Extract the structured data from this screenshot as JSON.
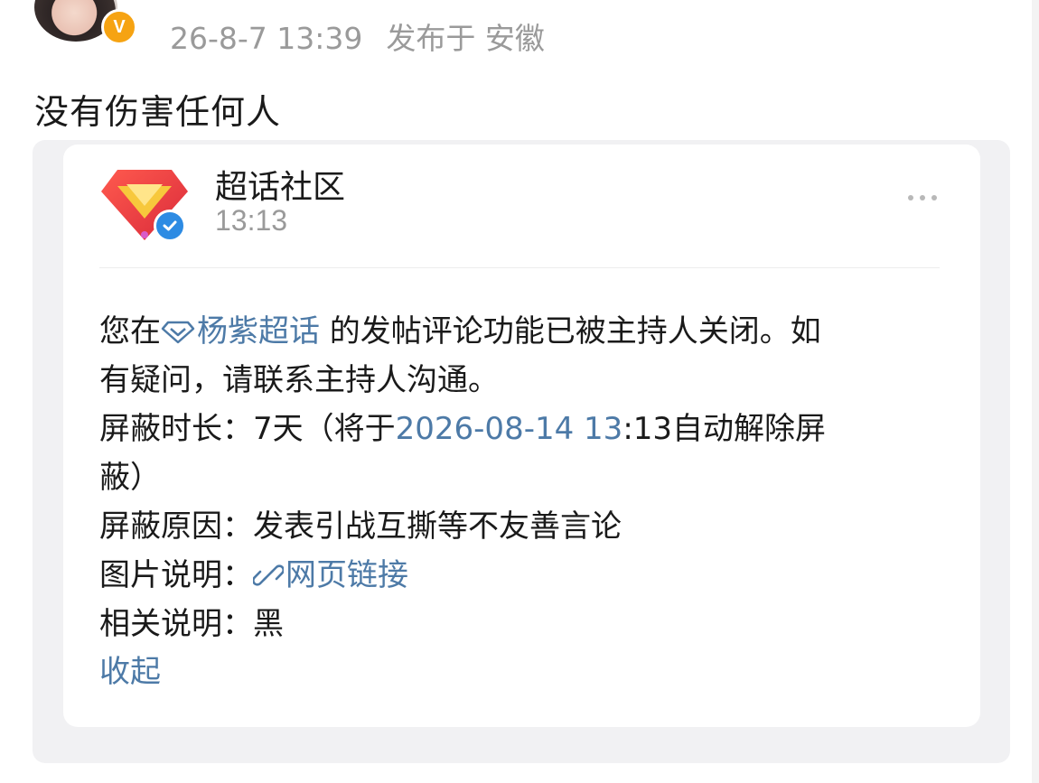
{
  "post": {
    "timestamp": "26-8-7 13:39",
    "location": "发布于 安徽",
    "text": "没有伤害任何人",
    "avatar_badge": "V"
  },
  "card": {
    "account_name": "超话社区",
    "time": "13:13",
    "logo_icon": "supertopic-diamond-logo",
    "verified_icon": "verified-check-icon",
    "more_icon": "more-dots-icon",
    "message": {
      "prefix": "您在",
      "topic": "杨紫超话",
      "line1_rest": " 的发帖评论功能已被主持人关闭。如",
      "line2": "有疑问，请联系主持人沟通。",
      "duration_label": "屏蔽时长：",
      "duration_value": "7天（将于",
      "duration_date": "2026-08-14 13",
      "duration_rest": ":13自动解除屏",
      "duration_line2": "蔽）",
      "reason_label": "屏蔽原因：",
      "reason_value": "发表引战互撕等不友善言论",
      "image_label": "图片说明：",
      "image_link": "网页链接",
      "related_label": "相关说明：",
      "related_value": "黑"
    },
    "collapse_label": "收起"
  },
  "colors": {
    "link": "#4d7aa7",
    "meta_gray": "#9a9a9a",
    "badge_orange": "#f6a312",
    "verified_blue": "#2d8be3",
    "logo_red": "#e8333b"
  }
}
